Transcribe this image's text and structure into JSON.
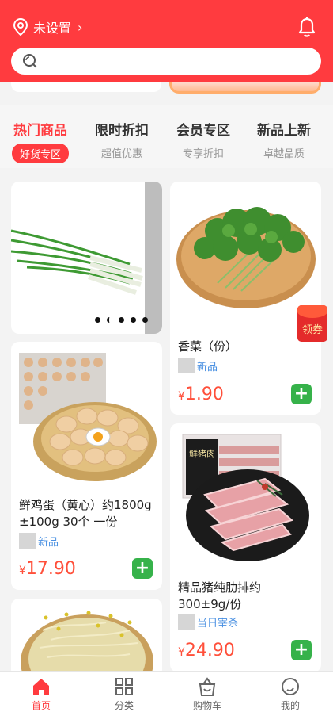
{
  "header": {
    "location": "未设置",
    "search_placeholder": ""
  },
  "tabs": [
    {
      "title": "热门商品",
      "sub": "好货专区"
    },
    {
      "title": "限时折扣",
      "sub": "超值优惠"
    },
    {
      "title": "会员专区",
      "sub": "专享折扣"
    },
    {
      "title": "新品上新",
      "sub": "卓越品质"
    }
  ],
  "products": [
    {
      "name": "香菜（份）",
      "tag": "新品",
      "currency": "¥",
      "price": "1.90"
    },
    {
      "name": "鲜鸡蛋（黄心）约1800g ±100g 30个 一份",
      "tag": "新品",
      "currency": "¥",
      "price": "17.90"
    },
    {
      "name": "精品猪纯肋排约300±9g/份",
      "tag": "当日宰杀",
      "currency": "¥",
      "price": "24.90"
    }
  ],
  "pork_label": "鲜猪肉",
  "coupon": "领券",
  "bottom_nav": [
    "首页",
    "分类",
    "购物车",
    "我的"
  ],
  "colors": {
    "brand": "#ff3b3f",
    "add": "#36b24a",
    "price": "#ff4f3a"
  }
}
